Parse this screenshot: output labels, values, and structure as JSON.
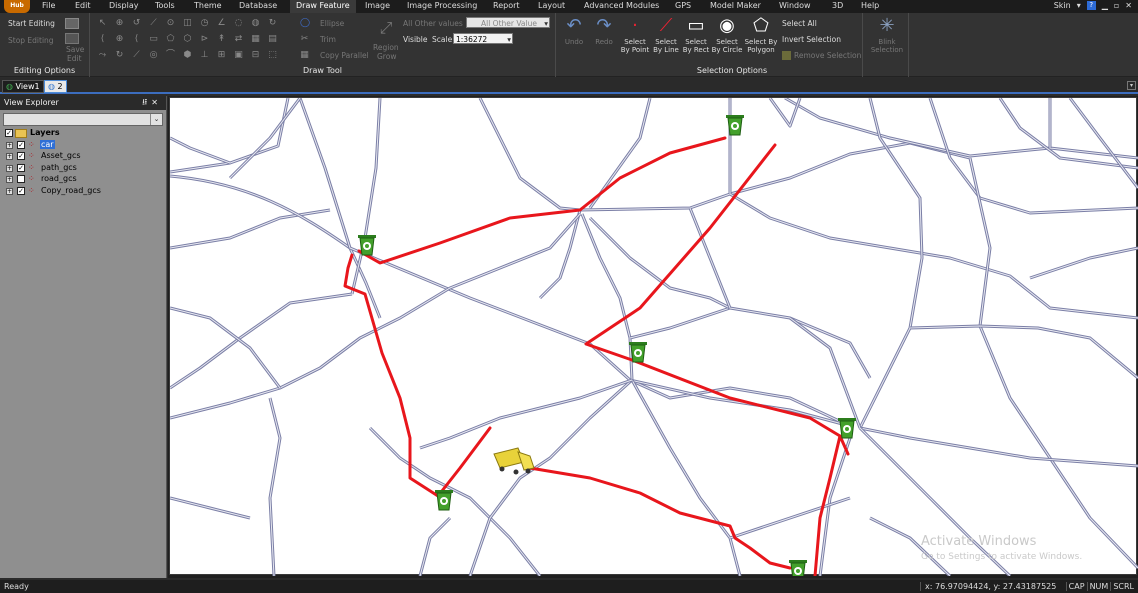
{
  "menu": {
    "logo_text": "Hub",
    "items": [
      "File",
      "Edit",
      "Display",
      "Tools",
      "Theme",
      "Database",
      "Draw Feature",
      "Image",
      "Image Processing",
      "Report",
      "Layout",
      "Advanced Modules",
      "GPS",
      "Model Maker",
      "Window",
      "3D",
      "Help"
    ],
    "active": "Draw Feature",
    "skin_label": "Skin",
    "help_icon": "?"
  },
  "ribbon": {
    "editing": {
      "start": "Start Editing",
      "stop": "Stop Editing",
      "save_line1": "Save",
      "save_line2": "Edit",
      "group_label": "Editing Options"
    },
    "draw_tool": {
      "ellipse": "Ellipse",
      "trim": "Trim",
      "copy_parallel": "Copy Parallel",
      "region_line1": "Region",
      "region_line2": "Grow",
      "all_other_values": "All Other values",
      "all_other_value_select": "All Other Value",
      "visible": "Visible",
      "scale_label": "Scale",
      "scale_value": "1:36272",
      "group_label": "Draw Tool"
    },
    "selection": {
      "undo": "Undo",
      "redo": "Redo",
      "by_point": [
        "Select",
        "By Point"
      ],
      "by_line": [
        "Select",
        "By Line"
      ],
      "by_rect": [
        "Select",
        "By Rect"
      ],
      "by_circle": [
        "Select",
        "By Circle"
      ],
      "by_polygon": [
        "Select By",
        "Polygon"
      ],
      "select_all": "Select All",
      "invert": "Invert Selection",
      "remove": "Remove Selection",
      "blink_line1": "Blink",
      "blink_line2": "Selection",
      "group_label": "Selection Options"
    }
  },
  "tabs": [
    {
      "label": "View1"
    },
    {
      "label": "2"
    }
  ],
  "explorer": {
    "title": "View Explorer",
    "pin": "⭿",
    "close": "✕",
    "root": "Layers",
    "layers": [
      {
        "name": "car",
        "checked": true,
        "highlight": true
      },
      {
        "name": "Asset_gcs",
        "checked": true,
        "highlight": false
      },
      {
        "name": "path_gcs",
        "checked": true,
        "highlight": false
      },
      {
        "name": "road_gcs",
        "checked": false,
        "highlight": false
      },
      {
        "name": "Copy_road_gcs",
        "checked": true,
        "highlight": false
      }
    ]
  },
  "map": {
    "route_color": "#e8161c",
    "road_color": "#7b7fa6",
    "watermark_title": "Activate Windows",
    "watermark_sub": "Go to Settings to activate Windows."
  },
  "status": {
    "ready": "Ready",
    "coords": "x: 76.97094424,  y: 27.43187525",
    "keys": [
      "CAP",
      "NUM",
      "SCRL"
    ]
  }
}
